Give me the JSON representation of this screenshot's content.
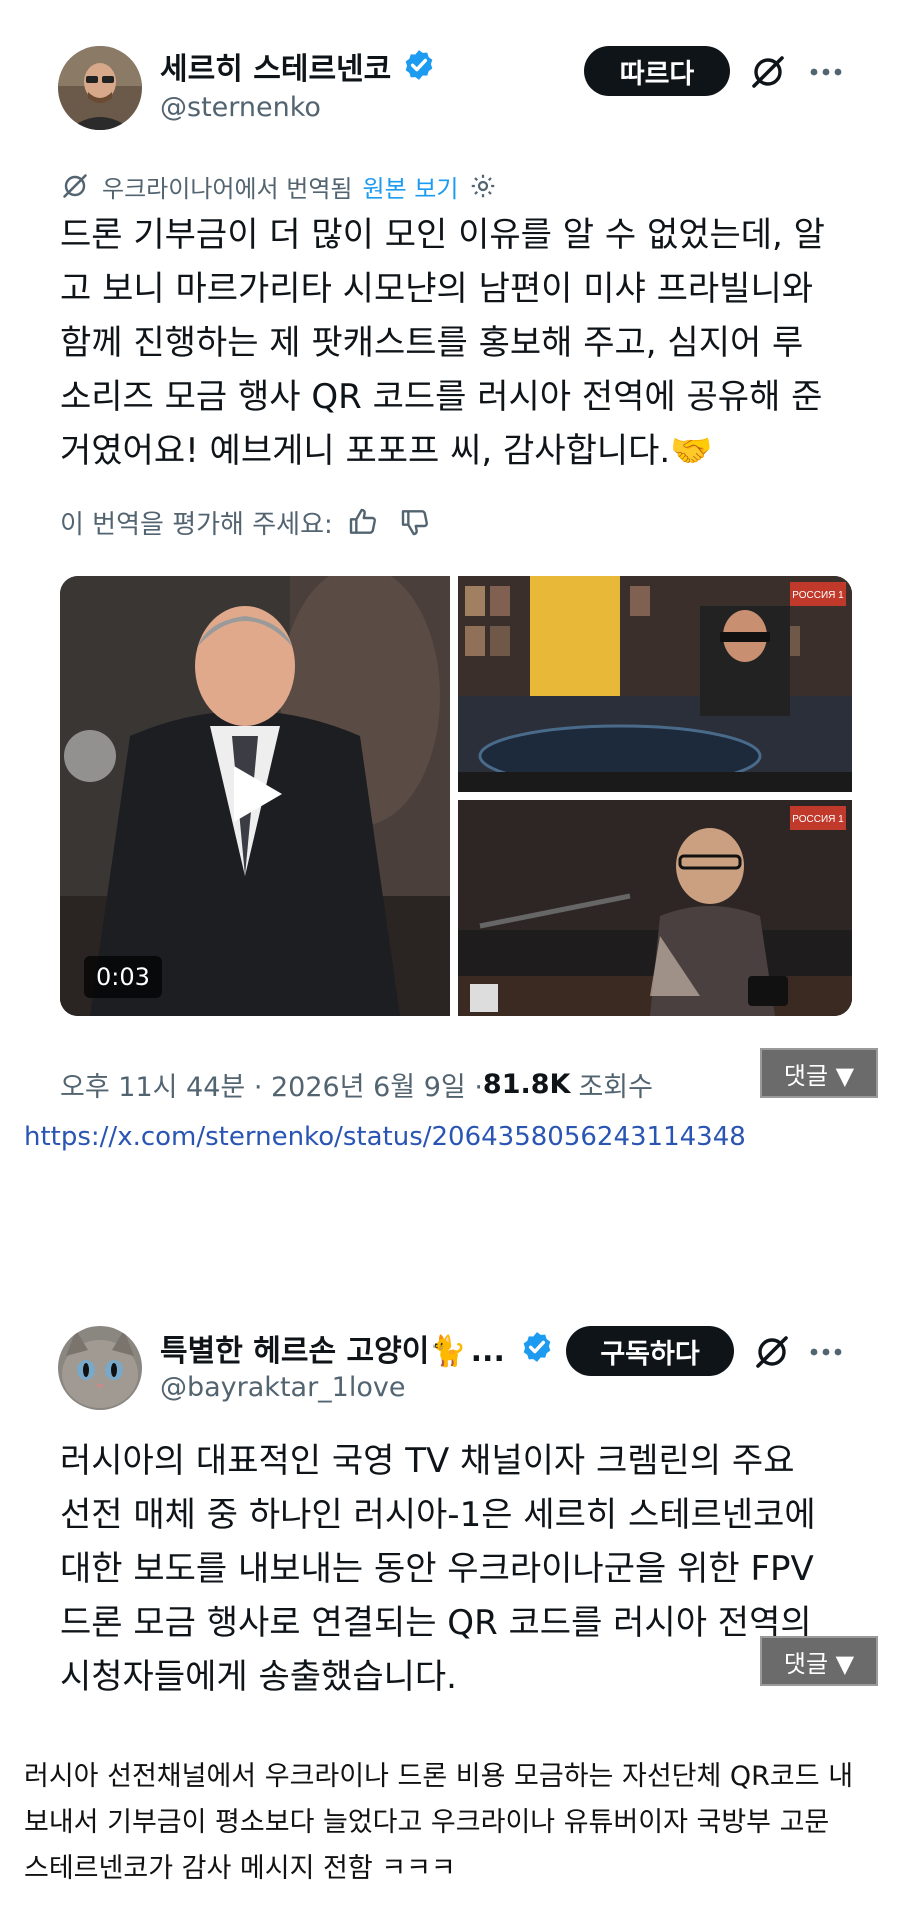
{
  "tweet1": {
    "display_name": "세르히 스테르넨코",
    "handle": "@sternenko",
    "follow_label": "따르다",
    "translated_label": "우크라이나어에서 번역됨",
    "show_original_label": "원본 보기",
    "body_lines": [
      "드론 기부금이 더 많이 모인 이유를 알 수 없었는데, 알",
      "고 보니 마르가리타 시모냔의 남편이 미샤 프라빌니와",
      "함께 진행하는 제 팟캐스트를 홍보해 주고, 심지어 루",
      "소리즈 모금 행사 QR 코드를 러시아 전역에 공유해 준",
      "거였어요! 예브게니 포포프 씨, 감사합니다."
    ],
    "handshake_emoji": "🤝",
    "rate_label": "이 번역을 평가해 주세요:",
    "video_duration": "0:03",
    "channel_badge": "РОССИЯ 1",
    "timestamp": "오후 11시 44분 · 2026년 6월 9일 · ",
    "views_count": "81.8K",
    "views_label": "조회수"
  },
  "comment_button_label": "댓글 ▼",
  "tweet_url": "https://x.com/sternenko/status/2064358056243114348",
  "tweet2": {
    "display_name": "특별한 헤르손 고양이",
    "name_emoji": "🐈",
    "name_ellipsis": "...",
    "handle": "@bayraktar_1love",
    "subscribe_label": "구독하다",
    "body_lines": [
      "러시아의 대표적인 국영 TV 채널이자 크렘린의 주요",
      "선전 매체 중 하나인 러시아-1은 세르히 스테르넨코에",
      "대한 보도를 내보내는 동안 우크라이나군을 위한 FPV",
      "드론 모금 행사로 연결되는 QR 코드를 러시아 전역의",
      "시청자들에게 송출했습니다."
    ]
  },
  "caption_lines": [
    "러시아 선전채널에서 우크라이나 드론 비용 모금하는 자선단체 QR코드 내",
    "보내서 기부금이 평소보다 늘었다고 우크라이나 유튜버이자 국방부 고문",
    "스테르넨코가 감사 메시지 전함 ㅋㅋㅋ"
  ],
  "colors": {
    "accent": "#1d9bf0",
    "link": "#2a55b3",
    "text": "#0f1419",
    "muted": "#536471"
  }
}
